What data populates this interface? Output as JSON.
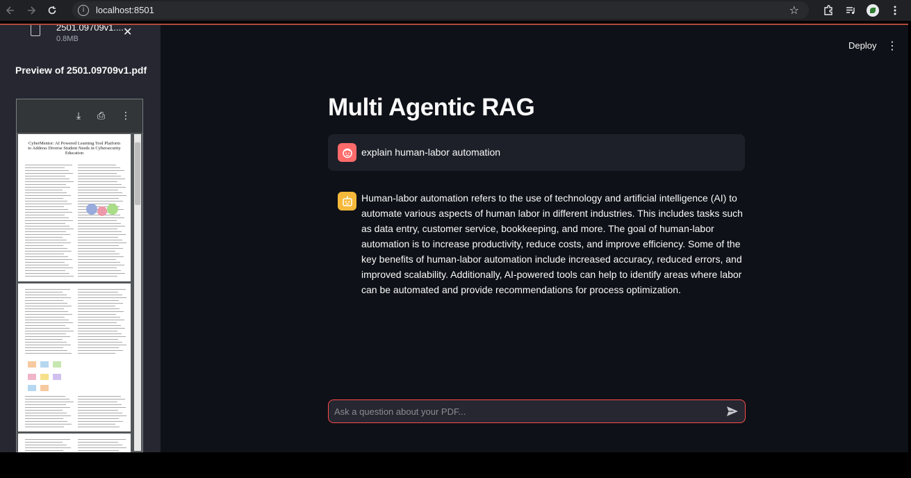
{
  "browser": {
    "url": "localhost:8501",
    "info_glyph": "i",
    "star_glyph": "☆"
  },
  "sidebar": {
    "file": {
      "name": "2501.09709v1....",
      "size": "0.8MB",
      "close_glyph": "✕"
    },
    "preview_title": "Preview of 2501.09709v1.pdf",
    "pdf": {
      "download_glyph": "⤓",
      "print_glyph": "⎙",
      "more_glyph": "⋮",
      "page_heading": "CyberMentor: AI Powered Learning Tool Platform to Address Diverse Student Needs in Cybersecurity Education"
    }
  },
  "header": {
    "deploy_label": "Deploy",
    "menu_glyph": "⋮"
  },
  "main": {
    "title": "Multi Agentic RAG",
    "messages": [
      {
        "role": "user",
        "text": "explain human-labor automation"
      },
      {
        "role": "assistant",
        "text": "Human-labor automation refers to the use of technology and artificial intelligence (AI) to automate various aspects of human labor in different industries. This includes tasks such as data entry, customer service, bookkeeping, and more. The goal of human-labor automation is to increase productivity, reduce costs, and improve efficiency. Some of the key benefits of human-labor automation include increased accuracy, reduced errors, and improved scalability. Additionally, AI-powered tools can help to identify areas where labor can be automated and provide recommendations for process optimization."
      }
    ],
    "chat_input": {
      "placeholder": "Ask a question about your PDF..."
    }
  },
  "colors": {
    "app_bg": "#0e1117",
    "sidebar_bg": "#262730",
    "accent": "#ff4b4b",
    "user_avatar": "#ff6b6b",
    "bot_avatar": "#f6b93b"
  }
}
